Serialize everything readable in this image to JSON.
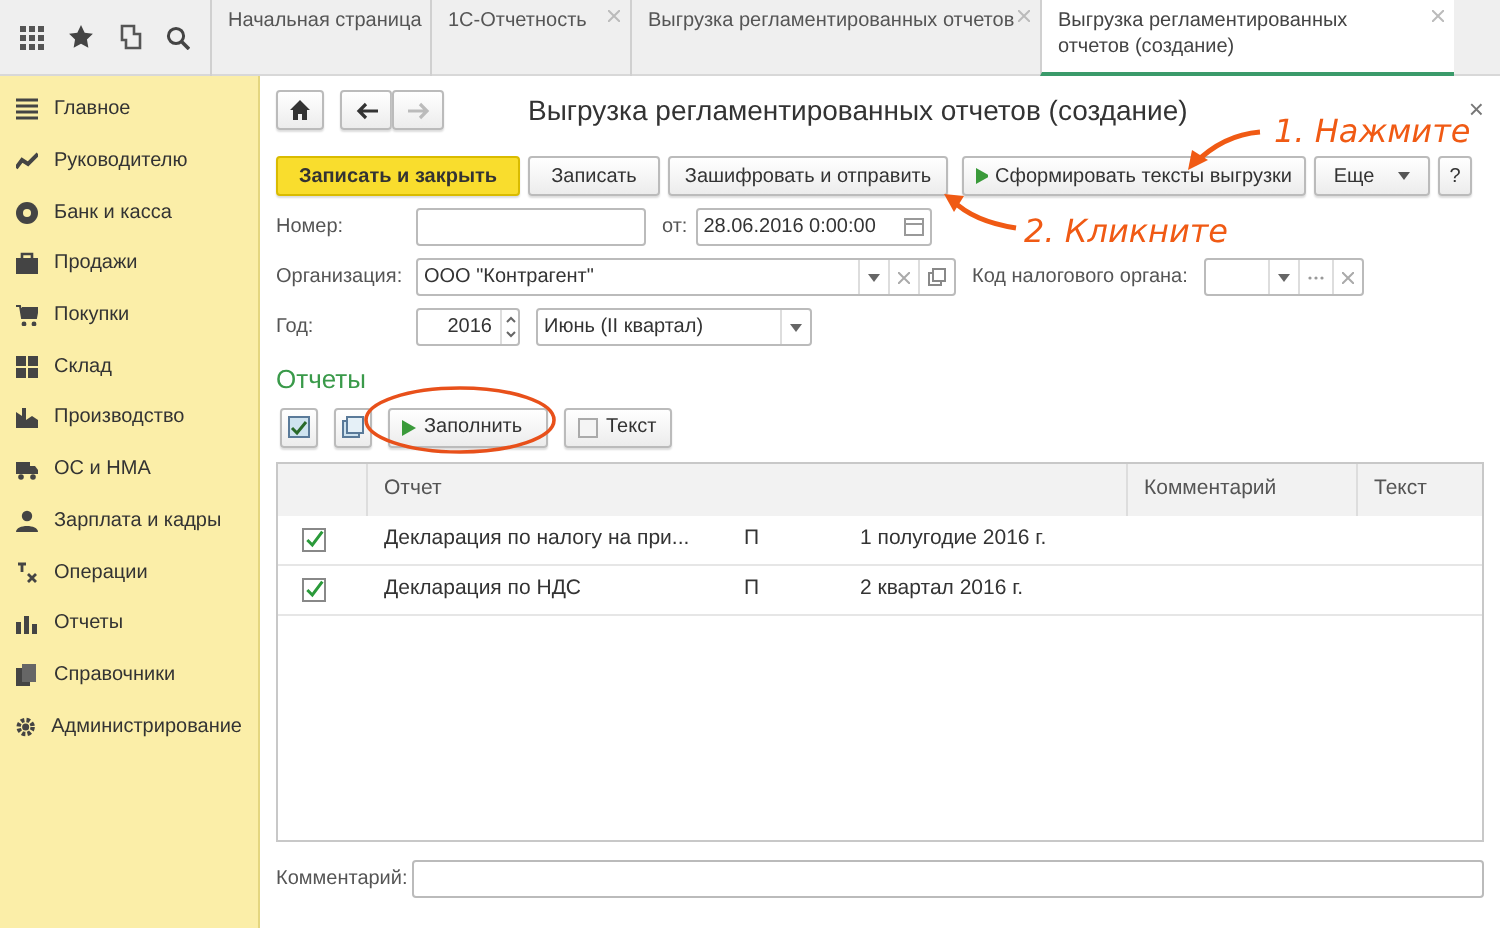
{
  "tabs": [
    {
      "label": "Начальная страница",
      "closable": false,
      "selected": false
    },
    {
      "label": "1С-Отчетность",
      "closable": true,
      "selected": false
    },
    {
      "label": "Выгрузка регламентированных отчетов",
      "closable": true,
      "selected": false
    },
    {
      "label": "Выгрузка регламентированных отчетов (создание)",
      "closable": true,
      "selected": true
    }
  ],
  "sidebar": {
    "items": [
      {
        "label": "Главное"
      },
      {
        "label": "Руководителю"
      },
      {
        "label": "Банк и касса"
      },
      {
        "label": "Продажи"
      },
      {
        "label": "Покупки"
      },
      {
        "label": "Склад"
      },
      {
        "label": "Производство"
      },
      {
        "label": "ОС и НМА"
      },
      {
        "label": "Зарплата и кадры"
      },
      {
        "label": "Операции"
      },
      {
        "label": "Отчеты"
      },
      {
        "label": "Справочники"
      },
      {
        "label": "Администрирование"
      }
    ]
  },
  "form": {
    "title": "Выгрузка регламентированных отчетов (создание)",
    "close": "×",
    "toolbar": [
      {
        "label": "Записать и закрыть",
        "kind": "primary"
      },
      {
        "label": "Записать",
        "kind": "plain"
      },
      {
        "label": "Зашифровать и отправить",
        "kind": "plain"
      },
      {
        "label": "Сформировать тексты выгрузки",
        "kind": "play"
      },
      {
        "label": "Еще",
        "kind": "menu"
      },
      {
        "label": "?",
        "kind": "plain"
      }
    ],
    "number": {
      "label": "Номер:",
      "date_label": "от:",
      "date": "28.06.2016  0:00:00"
    },
    "organization": {
      "label": "Организация:",
      "value": "ООО \"Контрагент\""
    },
    "tax_office": {
      "label": "Код налогового органа:"
    },
    "year": {
      "label": "Год:",
      "value": "2016",
      "period": "Июнь (II квартал)"
    },
    "reports": {
      "heading": "Отчеты",
      "fill_button": "Заполнить",
      "text_button": "Текст",
      "columns": [
        "Отчет",
        "Комментарий",
        "Текст"
      ],
      "rows": [
        {
          "checked": true,
          "name": "Декларация по налогу на при...",
          "column_3": "П",
          "period": "1 полугодие 2016 г."
        },
        {
          "checked": true,
          "name": "Декларация по НДС",
          "column_3": "П",
          "period": "2 квартал 2016 г."
        }
      ]
    },
    "comment": {
      "label": "Комментарий:"
    }
  },
  "annotations": [
    "1. Нажмите",
    "2. Кликните"
  ]
}
